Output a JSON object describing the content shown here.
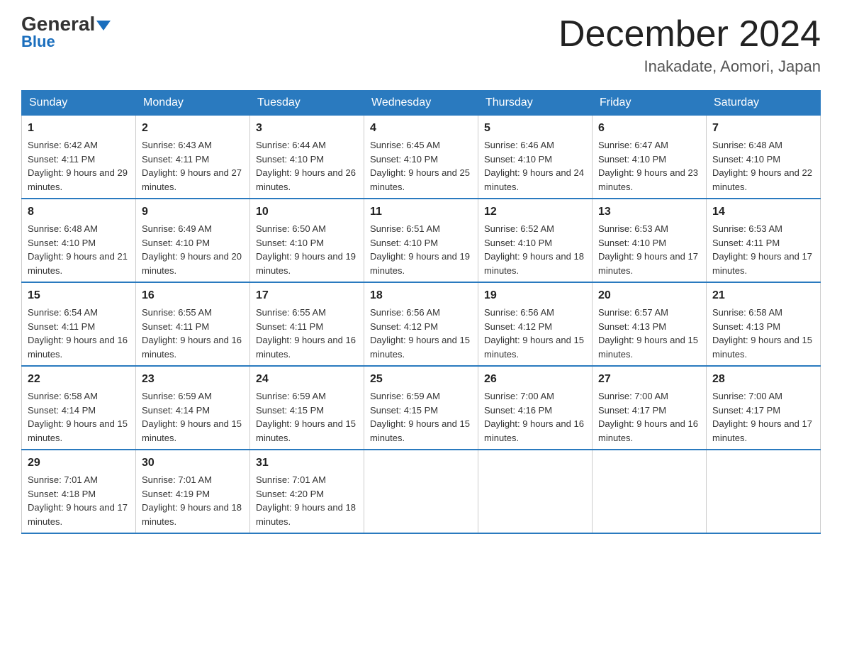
{
  "logo": {
    "general": "General",
    "blue": "Blue"
  },
  "header": {
    "month": "December 2024",
    "location": "Inakadate, Aomori, Japan"
  },
  "weekdays": [
    "Sunday",
    "Monday",
    "Tuesday",
    "Wednesday",
    "Thursday",
    "Friday",
    "Saturday"
  ],
  "weeks": [
    [
      {
        "day": "1",
        "sunrise": "Sunrise: 6:42 AM",
        "sunset": "Sunset: 4:11 PM",
        "daylight": "Daylight: 9 hours and 29 minutes."
      },
      {
        "day": "2",
        "sunrise": "Sunrise: 6:43 AM",
        "sunset": "Sunset: 4:11 PM",
        "daylight": "Daylight: 9 hours and 27 minutes."
      },
      {
        "day": "3",
        "sunrise": "Sunrise: 6:44 AM",
        "sunset": "Sunset: 4:10 PM",
        "daylight": "Daylight: 9 hours and 26 minutes."
      },
      {
        "day": "4",
        "sunrise": "Sunrise: 6:45 AM",
        "sunset": "Sunset: 4:10 PM",
        "daylight": "Daylight: 9 hours and 25 minutes."
      },
      {
        "day": "5",
        "sunrise": "Sunrise: 6:46 AM",
        "sunset": "Sunset: 4:10 PM",
        "daylight": "Daylight: 9 hours and 24 minutes."
      },
      {
        "day": "6",
        "sunrise": "Sunrise: 6:47 AM",
        "sunset": "Sunset: 4:10 PM",
        "daylight": "Daylight: 9 hours and 23 minutes."
      },
      {
        "day": "7",
        "sunrise": "Sunrise: 6:48 AM",
        "sunset": "Sunset: 4:10 PM",
        "daylight": "Daylight: 9 hours and 22 minutes."
      }
    ],
    [
      {
        "day": "8",
        "sunrise": "Sunrise: 6:48 AM",
        "sunset": "Sunset: 4:10 PM",
        "daylight": "Daylight: 9 hours and 21 minutes."
      },
      {
        "day": "9",
        "sunrise": "Sunrise: 6:49 AM",
        "sunset": "Sunset: 4:10 PM",
        "daylight": "Daylight: 9 hours and 20 minutes."
      },
      {
        "day": "10",
        "sunrise": "Sunrise: 6:50 AM",
        "sunset": "Sunset: 4:10 PM",
        "daylight": "Daylight: 9 hours and 19 minutes."
      },
      {
        "day": "11",
        "sunrise": "Sunrise: 6:51 AM",
        "sunset": "Sunset: 4:10 PM",
        "daylight": "Daylight: 9 hours and 19 minutes."
      },
      {
        "day": "12",
        "sunrise": "Sunrise: 6:52 AM",
        "sunset": "Sunset: 4:10 PM",
        "daylight": "Daylight: 9 hours and 18 minutes."
      },
      {
        "day": "13",
        "sunrise": "Sunrise: 6:53 AM",
        "sunset": "Sunset: 4:10 PM",
        "daylight": "Daylight: 9 hours and 17 minutes."
      },
      {
        "day": "14",
        "sunrise": "Sunrise: 6:53 AM",
        "sunset": "Sunset: 4:11 PM",
        "daylight": "Daylight: 9 hours and 17 minutes."
      }
    ],
    [
      {
        "day": "15",
        "sunrise": "Sunrise: 6:54 AM",
        "sunset": "Sunset: 4:11 PM",
        "daylight": "Daylight: 9 hours and 16 minutes."
      },
      {
        "day": "16",
        "sunrise": "Sunrise: 6:55 AM",
        "sunset": "Sunset: 4:11 PM",
        "daylight": "Daylight: 9 hours and 16 minutes."
      },
      {
        "day": "17",
        "sunrise": "Sunrise: 6:55 AM",
        "sunset": "Sunset: 4:11 PM",
        "daylight": "Daylight: 9 hours and 16 minutes."
      },
      {
        "day": "18",
        "sunrise": "Sunrise: 6:56 AM",
        "sunset": "Sunset: 4:12 PM",
        "daylight": "Daylight: 9 hours and 15 minutes."
      },
      {
        "day": "19",
        "sunrise": "Sunrise: 6:56 AM",
        "sunset": "Sunset: 4:12 PM",
        "daylight": "Daylight: 9 hours and 15 minutes."
      },
      {
        "day": "20",
        "sunrise": "Sunrise: 6:57 AM",
        "sunset": "Sunset: 4:13 PM",
        "daylight": "Daylight: 9 hours and 15 minutes."
      },
      {
        "day": "21",
        "sunrise": "Sunrise: 6:58 AM",
        "sunset": "Sunset: 4:13 PM",
        "daylight": "Daylight: 9 hours and 15 minutes."
      }
    ],
    [
      {
        "day": "22",
        "sunrise": "Sunrise: 6:58 AM",
        "sunset": "Sunset: 4:14 PM",
        "daylight": "Daylight: 9 hours and 15 minutes."
      },
      {
        "day": "23",
        "sunrise": "Sunrise: 6:59 AM",
        "sunset": "Sunset: 4:14 PM",
        "daylight": "Daylight: 9 hours and 15 minutes."
      },
      {
        "day": "24",
        "sunrise": "Sunrise: 6:59 AM",
        "sunset": "Sunset: 4:15 PM",
        "daylight": "Daylight: 9 hours and 15 minutes."
      },
      {
        "day": "25",
        "sunrise": "Sunrise: 6:59 AM",
        "sunset": "Sunset: 4:15 PM",
        "daylight": "Daylight: 9 hours and 15 minutes."
      },
      {
        "day": "26",
        "sunrise": "Sunrise: 7:00 AM",
        "sunset": "Sunset: 4:16 PM",
        "daylight": "Daylight: 9 hours and 16 minutes."
      },
      {
        "day": "27",
        "sunrise": "Sunrise: 7:00 AM",
        "sunset": "Sunset: 4:17 PM",
        "daylight": "Daylight: 9 hours and 16 minutes."
      },
      {
        "day": "28",
        "sunrise": "Sunrise: 7:00 AM",
        "sunset": "Sunset: 4:17 PM",
        "daylight": "Daylight: 9 hours and 17 minutes."
      }
    ],
    [
      {
        "day": "29",
        "sunrise": "Sunrise: 7:01 AM",
        "sunset": "Sunset: 4:18 PM",
        "daylight": "Daylight: 9 hours and 17 minutes."
      },
      {
        "day": "30",
        "sunrise": "Sunrise: 7:01 AM",
        "sunset": "Sunset: 4:19 PM",
        "daylight": "Daylight: 9 hours and 18 minutes."
      },
      {
        "day": "31",
        "sunrise": "Sunrise: 7:01 AM",
        "sunset": "Sunset: 4:20 PM",
        "daylight": "Daylight: 9 hours and 18 minutes."
      },
      null,
      null,
      null,
      null
    ]
  ]
}
